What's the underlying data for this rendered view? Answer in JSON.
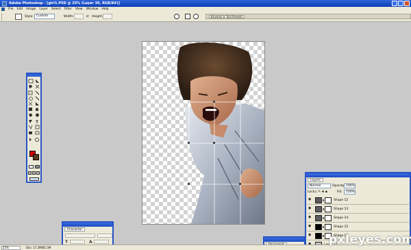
{
  "window": {
    "title": "Adobe Photoshop - [girl1.PSD @ 25% (Layer 30, RGB/8#)]"
  },
  "menu": [
    "File",
    "Edit",
    "Image",
    "Layer",
    "Select",
    "Filter",
    "View",
    "Window",
    "Help"
  ],
  "options": {
    "style_label": "Style:",
    "style_value": "Custom",
    "width_label": "Width:",
    "height_label": "Height:"
  },
  "wells": [
    "Brushes",
    "Tool Presets"
  ],
  "layers_panel": {
    "tab": "Layers",
    "blend_mode": "Normal",
    "opacity_label": "Opacity:",
    "opacity_value": "100%",
    "lock_label": "Lock:",
    "fill_label": "Fill:",
    "fill_value": "100%",
    "layers": [
      {
        "name": "Shape 12",
        "thumb": "gray"
      },
      {
        "name": "Shape 13",
        "thumb": "gray"
      },
      {
        "name": "Shape 14",
        "thumb": "gray"
      },
      {
        "name": "Shape 15",
        "thumb": "black"
      },
      {
        "name": "Shape 16",
        "thumb": "black"
      },
      {
        "name": "Layer 11",
        "thumb": "gray"
      }
    ]
  },
  "character_panel": {
    "tab": "Character"
  },
  "paragraph_panel": {
    "tab": "Paragraph"
  },
  "toolbox": {
    "foreground_color": "#d40000",
    "background_color": "#5a3a1c"
  },
  "status": {
    "zoom": "25%",
    "doc": "Doc: 17.2M/81.5M"
  },
  "watermark": "pxleyes.com"
}
